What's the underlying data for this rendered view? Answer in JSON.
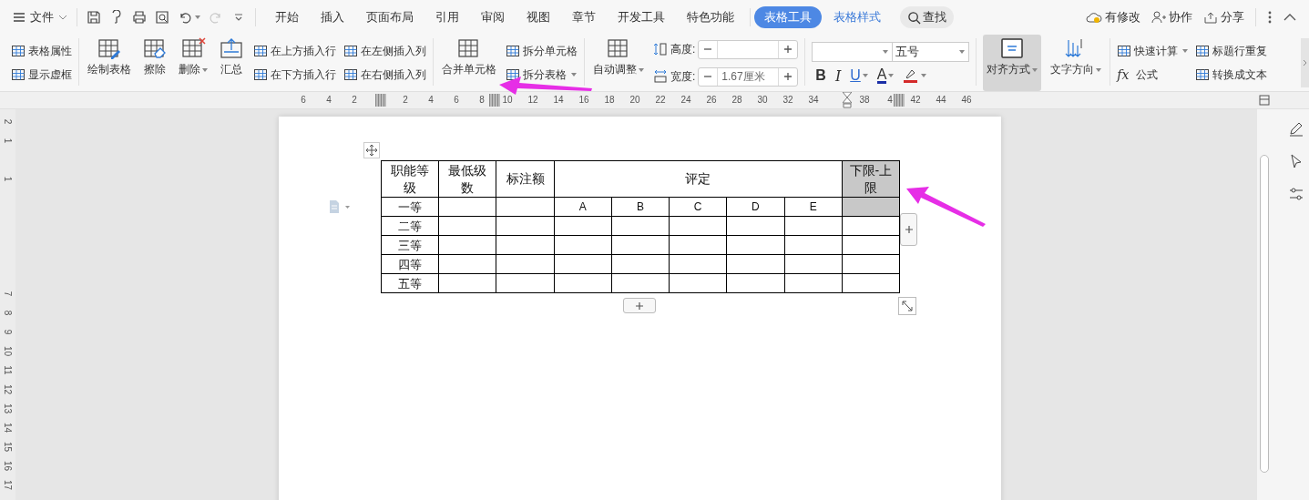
{
  "title_bar": {
    "file_menu": "文件",
    "redo": {
      "disabled": true
    },
    "tabs": [
      {
        "label": "开始",
        "selected": false,
        "contextual": false
      },
      {
        "label": "插入",
        "selected": false,
        "contextual": false
      },
      {
        "label": "页面布局",
        "selected": false,
        "contextual": false
      },
      {
        "label": "引用",
        "selected": false,
        "contextual": false
      },
      {
        "label": "审阅",
        "selected": false,
        "contextual": false
      },
      {
        "label": "视图",
        "selected": false,
        "contextual": false
      },
      {
        "label": "章节",
        "selected": false,
        "contextual": false
      },
      {
        "label": "开发工具",
        "selected": false,
        "contextual": false
      },
      {
        "label": "特色功能",
        "selected": false,
        "contextual": false
      },
      {
        "label": "表格工具",
        "selected": true,
        "contextual": true
      },
      {
        "label": "表格样式",
        "selected": false,
        "contextual": true
      }
    ],
    "search": "查找",
    "actions": [
      {
        "label": "有修改"
      },
      {
        "label": "协作"
      },
      {
        "label": "分享"
      }
    ]
  },
  "ribbon": {
    "groups": [
      {
        "columns": [
          {
            "kind": "stack",
            "items": [
              {
                "label": "表格属性",
                "dropdown": false
              },
              {
                "label": "显示虚框",
                "dropdown": false
              }
            ]
          }
        ]
      },
      {
        "columns": [
          {
            "kind": "big",
            "label": "绘制表格",
            "dropdown": false,
            "selected": false
          },
          {
            "kind": "big",
            "label": "擦除",
            "dropdown": false,
            "selected": false
          },
          {
            "kind": "big",
            "label": "删除",
            "dropdown": true,
            "selected": false
          },
          {
            "kind": "big",
            "label": "汇总",
            "dropdown": false,
            "selected": false
          },
          {
            "kind": "stack",
            "items": [
              {
                "label": "在上方插入行",
                "dropdown": false
              },
              {
                "label": "在下方插入行",
                "dropdown": false
              }
            ]
          },
          {
            "kind": "stack",
            "items": [
              {
                "label": "在左侧插入列",
                "dropdown": false
              },
              {
                "label": "在右侧插入列",
                "dropdown": false
              }
            ]
          }
        ]
      },
      {
        "columns": [
          {
            "kind": "big",
            "label": "合并单元格",
            "dropdown": false,
            "selected": false
          },
          {
            "kind": "stack",
            "items": [
              {
                "label": "拆分单元格",
                "dropdown": false
              },
              {
                "label": "拆分表格",
                "dropdown": true
              }
            ]
          }
        ]
      },
      {
        "columns": [
          {
            "kind": "big",
            "label": "自动调整",
            "dropdown": true,
            "selected": false
          },
          {
            "kind": "spin",
            "items": [
              {
                "label": "高度:"
              },
              {
                "label": "宽度:",
                "value": "1.67厘米"
              }
            ]
          }
        ]
      },
      {
        "columns": [
          {
            "kind": "font",
            "font_size": "五号",
            "buttons": [
              {
                "kind": "bold",
                "glyph": "B",
                "dropdown": false
              },
              {
                "kind": "italic",
                "glyph": "I",
                "dropdown": false
              },
              {
                "kind": "underline",
                "glyph": "U",
                "dropdown": true
              },
              {
                "kind": "font_color",
                "glyph": "A",
                "dropdown": true,
                "color": "#1b2fa6"
              },
              {
                "kind": "highlight",
                "dropdown": true,
                "color": "#d42a2a"
              }
            ]
          }
        ]
      },
      {
        "columns": [
          {
            "kind": "big",
            "label": "对齐方式",
            "dropdown": true,
            "selected": true
          },
          {
            "kind": "big",
            "label": "文字方向",
            "dropdown": true,
            "selected": false
          }
        ]
      },
      {
        "columns": [
          {
            "kind": "stack",
            "items": [
              {
                "label": "快速计算",
                "dropdown": true
              },
              {
                "label": "公式",
                "glyph": "fx",
                "dropdown": false
              }
            ]
          },
          {
            "kind": "stack",
            "items": [
              {
                "label": "标题行重复",
                "dropdown": false
              },
              {
                "label": "转换成文本",
                "dropdown": false
              }
            ]
          }
        ]
      }
    ]
  },
  "rulers": {
    "horizontal": [
      "6",
      "4",
      "2",
      "2",
      "4",
      "6",
      "8",
      "10",
      "12",
      "14",
      "16",
      "18",
      "20",
      "22",
      "24",
      "26",
      "28",
      "30",
      "32",
      "34",
      "38",
      "4",
      "42",
      "44",
      "46"
    ],
    "vertical": [
      "2",
      "1",
      "1",
      "7",
      "8",
      "9",
      "10",
      "11",
      "12",
      "13",
      "14",
      "15",
      "16",
      "17"
    ]
  },
  "document": {
    "table": {
      "rows": [
        [
          {
            "text": "职能等级",
            "selected": false
          },
          {
            "text": "最低级数",
            "selected": false
          },
          {
            "text": "标注额",
            "selected": false
          },
          {
            "text": "评定",
            "colspan": 5,
            "selected": false
          },
          {
            "text": "下限-上限",
            "selected": true
          }
        ],
        [
          {
            "text": "一等",
            "selected": false
          },
          {
            "selected": false
          },
          {
            "selected": false
          },
          {
            "text": "A",
            "selected": false
          },
          {
            "text": "B",
            "selected": false
          },
          {
            "text": "C",
            "selected": false
          },
          {
            "text": "D",
            "selected": false
          },
          {
            "text": "E",
            "selected": false
          },
          {
            "selected": true
          }
        ],
        [
          {
            "text": "二等",
            "selected": false
          },
          {
            "selected": false
          },
          {
            "selected": false
          },
          {
            "selected": false
          },
          {
            "selected": false
          },
          {
            "selected": false
          },
          {
            "selected": false
          },
          {
            "selected": false
          },
          {
            "selected": false
          }
        ],
        [
          {
            "text": "三等",
            "selected": false
          },
          {
            "selected": false
          },
          {
            "selected": false
          },
          {
            "selected": false
          },
          {
            "selected": false
          },
          {
            "selected": false
          },
          {
            "selected": false
          },
          {
            "selected": false
          },
          {
            "selected": false
          }
        ],
        [
          {
            "text": "四等",
            "selected": false
          },
          {
            "selected": false
          },
          {
            "selected": false
          },
          {
            "selected": false
          },
          {
            "selected": false
          },
          {
            "selected": false
          },
          {
            "selected": false
          },
          {
            "selected": false
          },
          {
            "selected": false
          }
        ],
        [
          {
            "text": "五等",
            "selected": false
          },
          {
            "selected": false
          },
          {
            "selected": false
          },
          {
            "selected": false
          },
          {
            "selected": false
          },
          {
            "selected": false
          },
          {
            "selected": false
          },
          {
            "selected": false
          },
          {
            "selected": false
          }
        ]
      ]
    }
  }
}
